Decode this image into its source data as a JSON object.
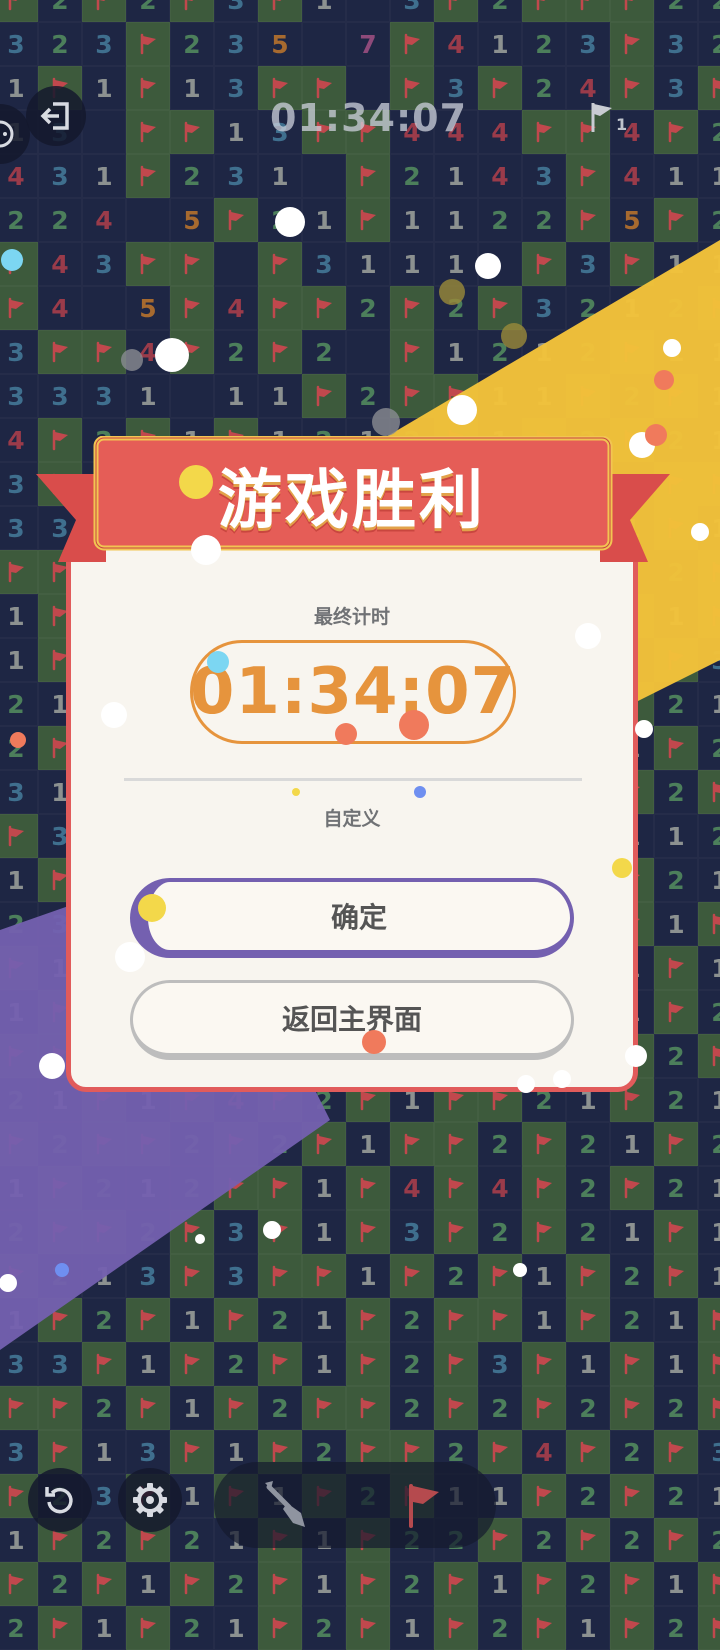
{
  "hud": {
    "timer": "01:34:07",
    "flags_remaining": "1",
    "exit_icon": "exit-icon",
    "chat_icon": "chat-icon"
  },
  "dialog": {
    "title": "游戏胜利",
    "final_time_label": "最终计时",
    "final_time": "01:34:07",
    "mode": "自定义",
    "confirm_label": "确定",
    "home_label": "返回主界面"
  },
  "toolbar": {
    "undo_icon": "undo-icon",
    "settings_icon": "gear-icon",
    "dig_icon": "shovel-icon",
    "flag_icon": "flag-icon"
  },
  "colors": {
    "accent_red": "#e15b5b",
    "accent_orange": "#e6943d",
    "accent_purple": "#7460b0",
    "beam_yellow": "#f3c23a",
    "board_bg": "#1c2340"
  },
  "board": [
    "F2F2F3F1.3F2FFF22",
    "323F235.7F4123F32",
    "1F1F13FF.F3F24F3F",
    "13.FF13FF444FF4F2",
    "431F231.F2143F411",
    "224.5F21F1122F5F2",
    "F43FF.F3111.F3F11",
    "F4.5F4FF2F2F3212F",
    "3FF4F2F2.F1212F11",
    "3331.11F2FF11F2F1",
    "4F2F1F1212F1F2F21",
    "3F2FF41F5F4F2F2FF",
    "33F1F131F1FF2F1F1",
    "FF1F4F233F2F1F22F",
    "1F2FF3232F2F11F1F",
    "1F2F4F3FF32F1F5F3",
    "21F3FFF1F232F3F21",
    "2F1F1F2F2F11FF1F2",
    "31F1F2F13FF222F2F",
    "F31F2F12F21FFF112",
    "1F1FF1F3F2F4F2F21",
    "232F1F31FF2FF3F1F",
    "F1F2F1F1F23F1F1F1",
    "1F2FF22FFF3F221F2",
    "FF2F23F1F3F2F1F2F",
    "21F1F4F2F1FF21F21",
    "F2FF2F2F1FF2F21F2",
    "1F212FF1F4F4F2F21",
    "2FF2F3F1F3F2F21F1",
    "F213F3FF1F2F1F2F1",
    "1F2F1F21F2FF1F21F",
    "33F1F2F1F2F3F1F1F",
    "FF2F1F2FF2F2F2F2F",
    "3F13F1F2FF2F4F2F3",
    "F23F1F1F2F11F2F21",
    "1F2F21F1F22F2F2F2",
    "F2F1F2F1F2F1F2F1F",
    "2F1F21F2F1F2F1F2F"
  ]
}
